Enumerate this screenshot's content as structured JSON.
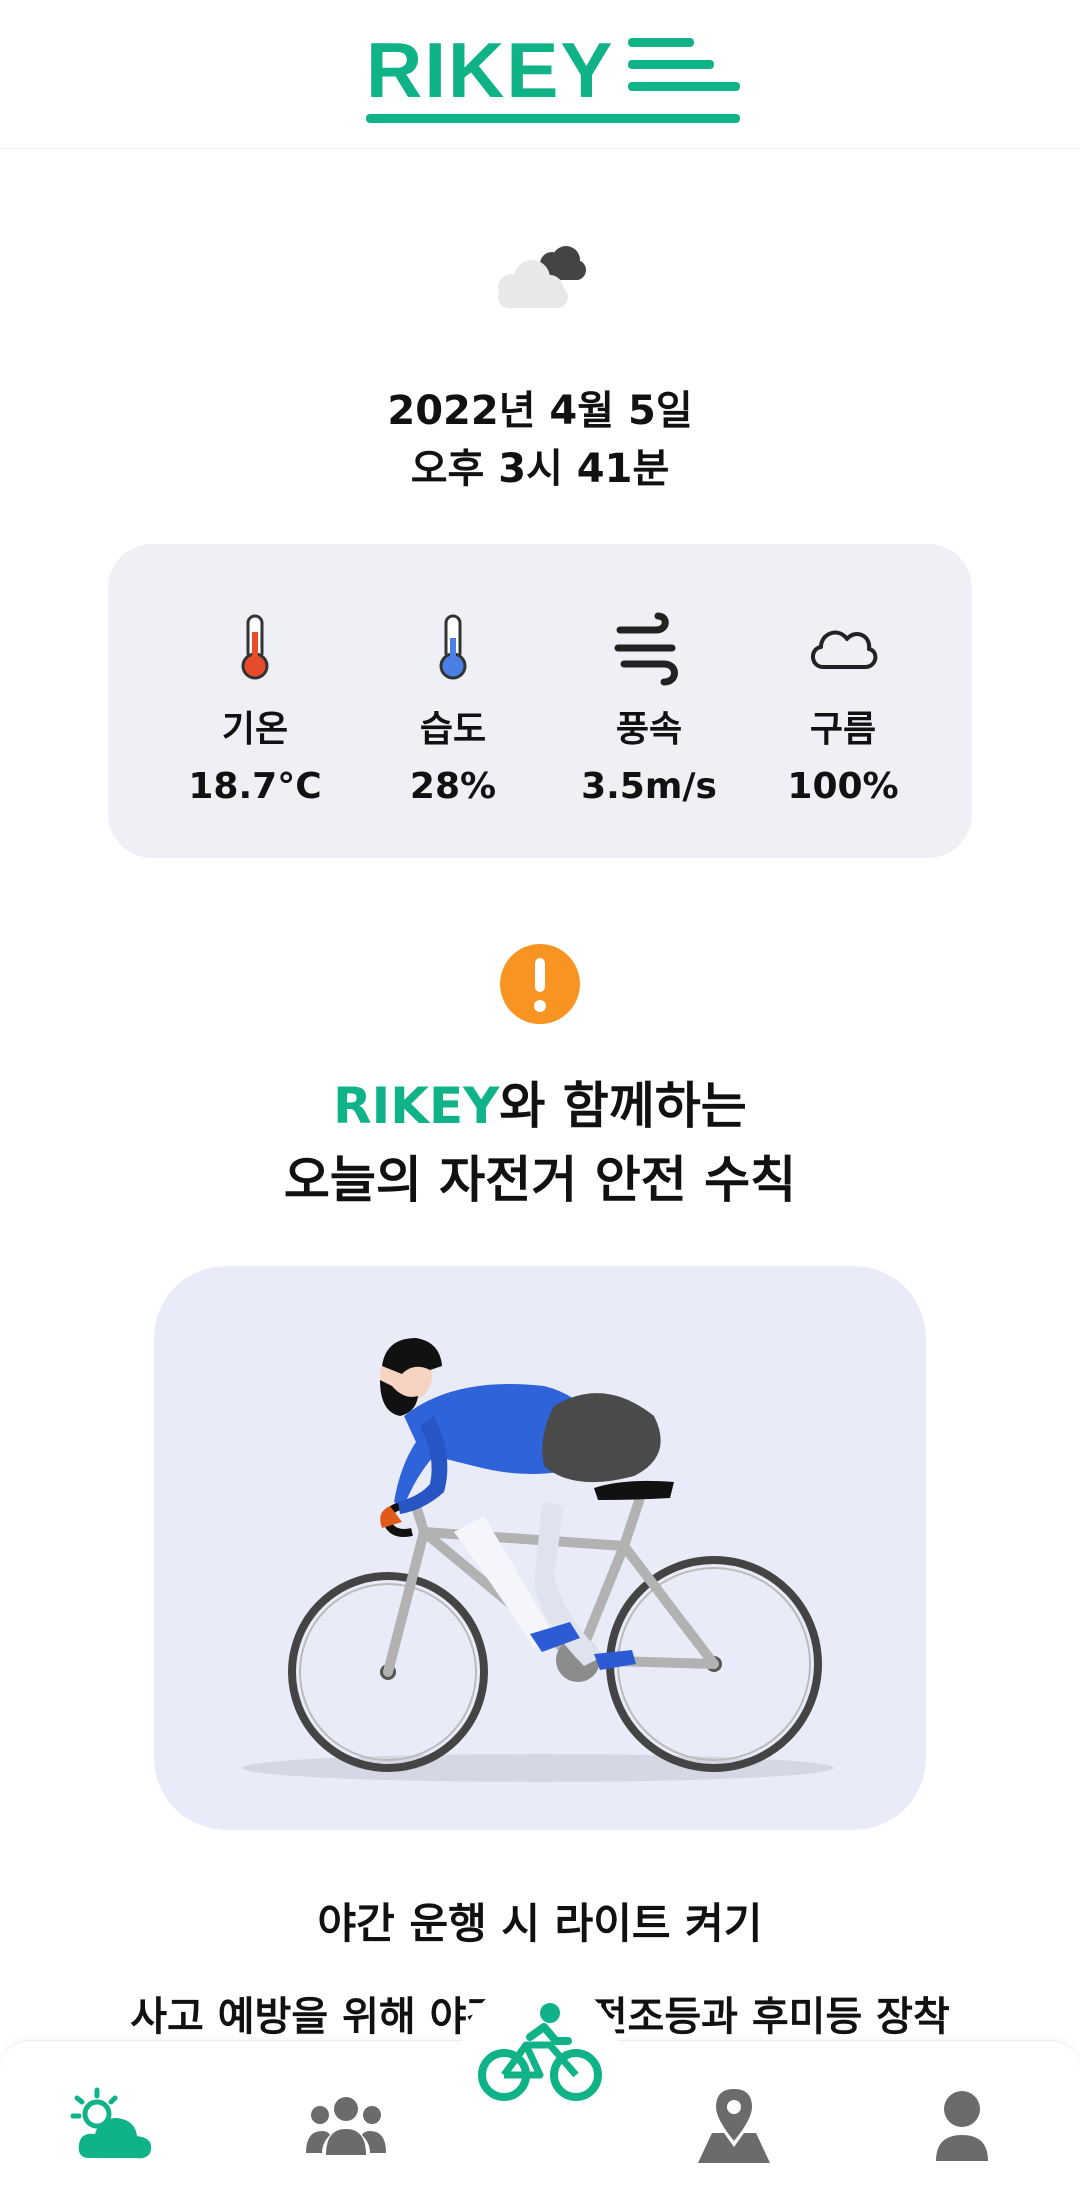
{
  "app": {
    "logo_text": "RIKEY",
    "accent": "#10b287"
  },
  "weather": {
    "icon": "cloudy-icon",
    "date": "2022년 4월 5일",
    "time": "오후 3시 41분",
    "stats": [
      {
        "label": "기온",
        "value": "18.7°C",
        "icon": "thermometer-hot-icon"
      },
      {
        "label": "습도",
        "value": "28%",
        "icon": "thermometer-cold-icon"
      },
      {
        "label": "풍속",
        "value": "3.5m/s",
        "icon": "wind-icon"
      },
      {
        "label": "구름",
        "value": "100%",
        "icon": "cloud-icon"
      }
    ]
  },
  "safety": {
    "brand": "RIKEY",
    "headline_suffix": "와 함께하는",
    "headline_line2": "오늘의 자전거 안전 수칙",
    "tip_title": "야간 운행 시 라이트 켜기",
    "tip_description": "사고 예방을 위해 야간에는 전조등과 후미등 장착"
  },
  "nav": {
    "items": [
      {
        "name": "weather",
        "icon": "weather-icon"
      },
      {
        "name": "community",
        "icon": "people-icon"
      },
      {
        "name": "ride",
        "icon": "bicycle-icon"
      },
      {
        "name": "map",
        "icon": "map-pin-icon"
      },
      {
        "name": "profile",
        "icon": "user-icon"
      }
    ]
  }
}
